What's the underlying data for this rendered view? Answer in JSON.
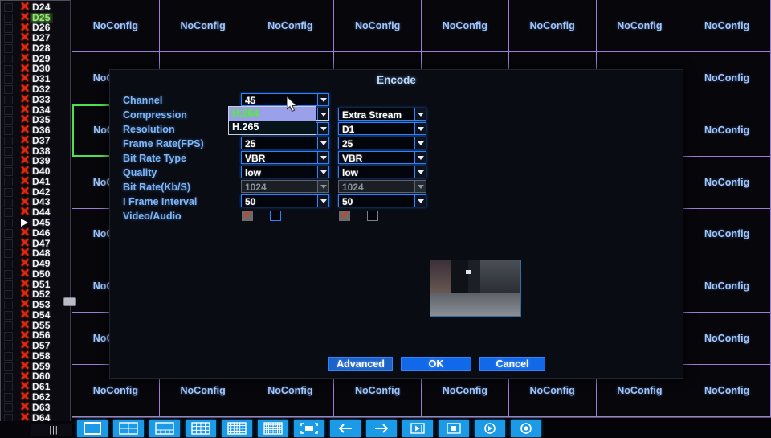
{
  "sidebar": {
    "channels": [
      {
        "label": "D24",
        "state": "x"
      },
      {
        "label": "D25",
        "state": "selected"
      },
      {
        "label": "D26",
        "state": "x"
      },
      {
        "label": "D27",
        "state": "x"
      },
      {
        "label": "D28",
        "state": "x"
      },
      {
        "label": "D29",
        "state": "x"
      },
      {
        "label": "D30",
        "state": "x"
      },
      {
        "label": "D31",
        "state": "x"
      },
      {
        "label": "D32",
        "state": "x"
      },
      {
        "label": "D33",
        "state": "x"
      },
      {
        "label": "D34",
        "state": "x"
      },
      {
        "label": "D35",
        "state": "x"
      },
      {
        "label": "D36",
        "state": "x"
      },
      {
        "label": "D37",
        "state": "x"
      },
      {
        "label": "D38",
        "state": "x"
      },
      {
        "label": "D39",
        "state": "x"
      },
      {
        "label": "D40",
        "state": "x"
      },
      {
        "label": "D41",
        "state": "x"
      },
      {
        "label": "D42",
        "state": "x"
      },
      {
        "label": "D43",
        "state": "x"
      },
      {
        "label": "D44",
        "state": "x"
      },
      {
        "label": "D45",
        "state": "play"
      },
      {
        "label": "D46",
        "state": "x"
      },
      {
        "label": "D47",
        "state": "x"
      },
      {
        "label": "D48",
        "state": "x"
      },
      {
        "label": "D49",
        "state": "x"
      },
      {
        "label": "D50",
        "state": "x"
      },
      {
        "label": "D51",
        "state": "x"
      },
      {
        "label": "D52",
        "state": "x"
      },
      {
        "label": "D53",
        "state": "x"
      },
      {
        "label": "D54",
        "state": "x"
      },
      {
        "label": "D55",
        "state": "x"
      },
      {
        "label": "D56",
        "state": "x"
      },
      {
        "label": "D57",
        "state": "x"
      },
      {
        "label": "D58",
        "state": "x"
      },
      {
        "label": "D59",
        "state": "x"
      },
      {
        "label": "D60",
        "state": "x"
      },
      {
        "label": "D61",
        "state": "x"
      },
      {
        "label": "D62",
        "state": "x"
      },
      {
        "label": "D63",
        "state": "x"
      },
      {
        "label": "D64",
        "state": "x"
      }
    ],
    "scroll_handle": "scrollbar-thumb",
    "bottom_handle": "|||"
  },
  "grid": {
    "cell_label": "NoConfig",
    "columns": 8,
    "rows": 8,
    "active_cell_index": 16,
    "border_color": "#9a7fd6",
    "active_border_color": "#4ee04e"
  },
  "dialog": {
    "title": "Encode",
    "rows": [
      {
        "label": "Channel",
        "main": "45",
        "sub": null,
        "main_state": "normal",
        "sub_state": "none"
      },
      {
        "label": "Compression",
        "main": "H.264",
        "sub": "Extra Stream",
        "main_state": "green-open",
        "sub_state": "normal"
      },
      {
        "label": "Resolution",
        "main": "",
        "sub": "D1",
        "main_state": "covered",
        "sub_state": "normal"
      },
      {
        "label": "Frame Rate(FPS)",
        "main": "25",
        "sub": "25",
        "main_state": "covered",
        "sub_state": "normal"
      },
      {
        "label": "Bit Rate Type",
        "main": "VBR",
        "sub": "VBR",
        "main_state": "normal",
        "sub_state": "normal"
      },
      {
        "label": "Quality",
        "main": "low",
        "sub": "low",
        "main_state": "normal",
        "sub_state": "normal"
      },
      {
        "label": "Bit Rate(Kb/S)",
        "main": "1024",
        "sub": "1024",
        "main_state": "disabled",
        "sub_state": "disabled"
      },
      {
        "label": "I Frame Interval",
        "main": "50",
        "sub": "50",
        "main_state": "normal",
        "sub_state": "normal"
      },
      {
        "label": "Video/Audio",
        "main": null,
        "sub": null,
        "main_state": "checkbox",
        "sub_state": "checkbox"
      }
    ],
    "dropdown": {
      "open_for": "Compression",
      "options": [
        {
          "label": "H.264",
          "highlighted": true
        },
        {
          "label": "H.265",
          "highlighted": false
        }
      ]
    },
    "checkboxes": {
      "main_video_checked": true,
      "main_audio_checked": false,
      "sub_video_checked": true,
      "sub_audio_checked": false
    },
    "buttons": {
      "advanced": "Advanced",
      "ok": "OK",
      "cancel": "Cancel"
    },
    "preview_name": "live-video-preview"
  },
  "toolbar": {
    "items": [
      {
        "name": "layout-1x1-icon"
      },
      {
        "name": "layout-2x2-icon"
      },
      {
        "name": "layout-pip-icon"
      },
      {
        "name": "layout-4x4-icon"
      },
      {
        "name": "layout-6x6-icon"
      },
      {
        "name": "layout-8x8-icon"
      },
      {
        "name": "fullscreen-icon"
      },
      {
        "name": "previous-page-icon"
      },
      {
        "name": "next-page-icon"
      },
      {
        "name": "playback-step-icon"
      },
      {
        "name": "snapshot-icon"
      },
      {
        "name": "play-circle-icon"
      },
      {
        "name": "record-circle-icon"
      }
    ]
  },
  "colors": {
    "accent_blue": "#2a85ff",
    "grid_purple": "#9a7fd6",
    "active_green": "#4ee04e",
    "x_red": "#e8260c"
  }
}
